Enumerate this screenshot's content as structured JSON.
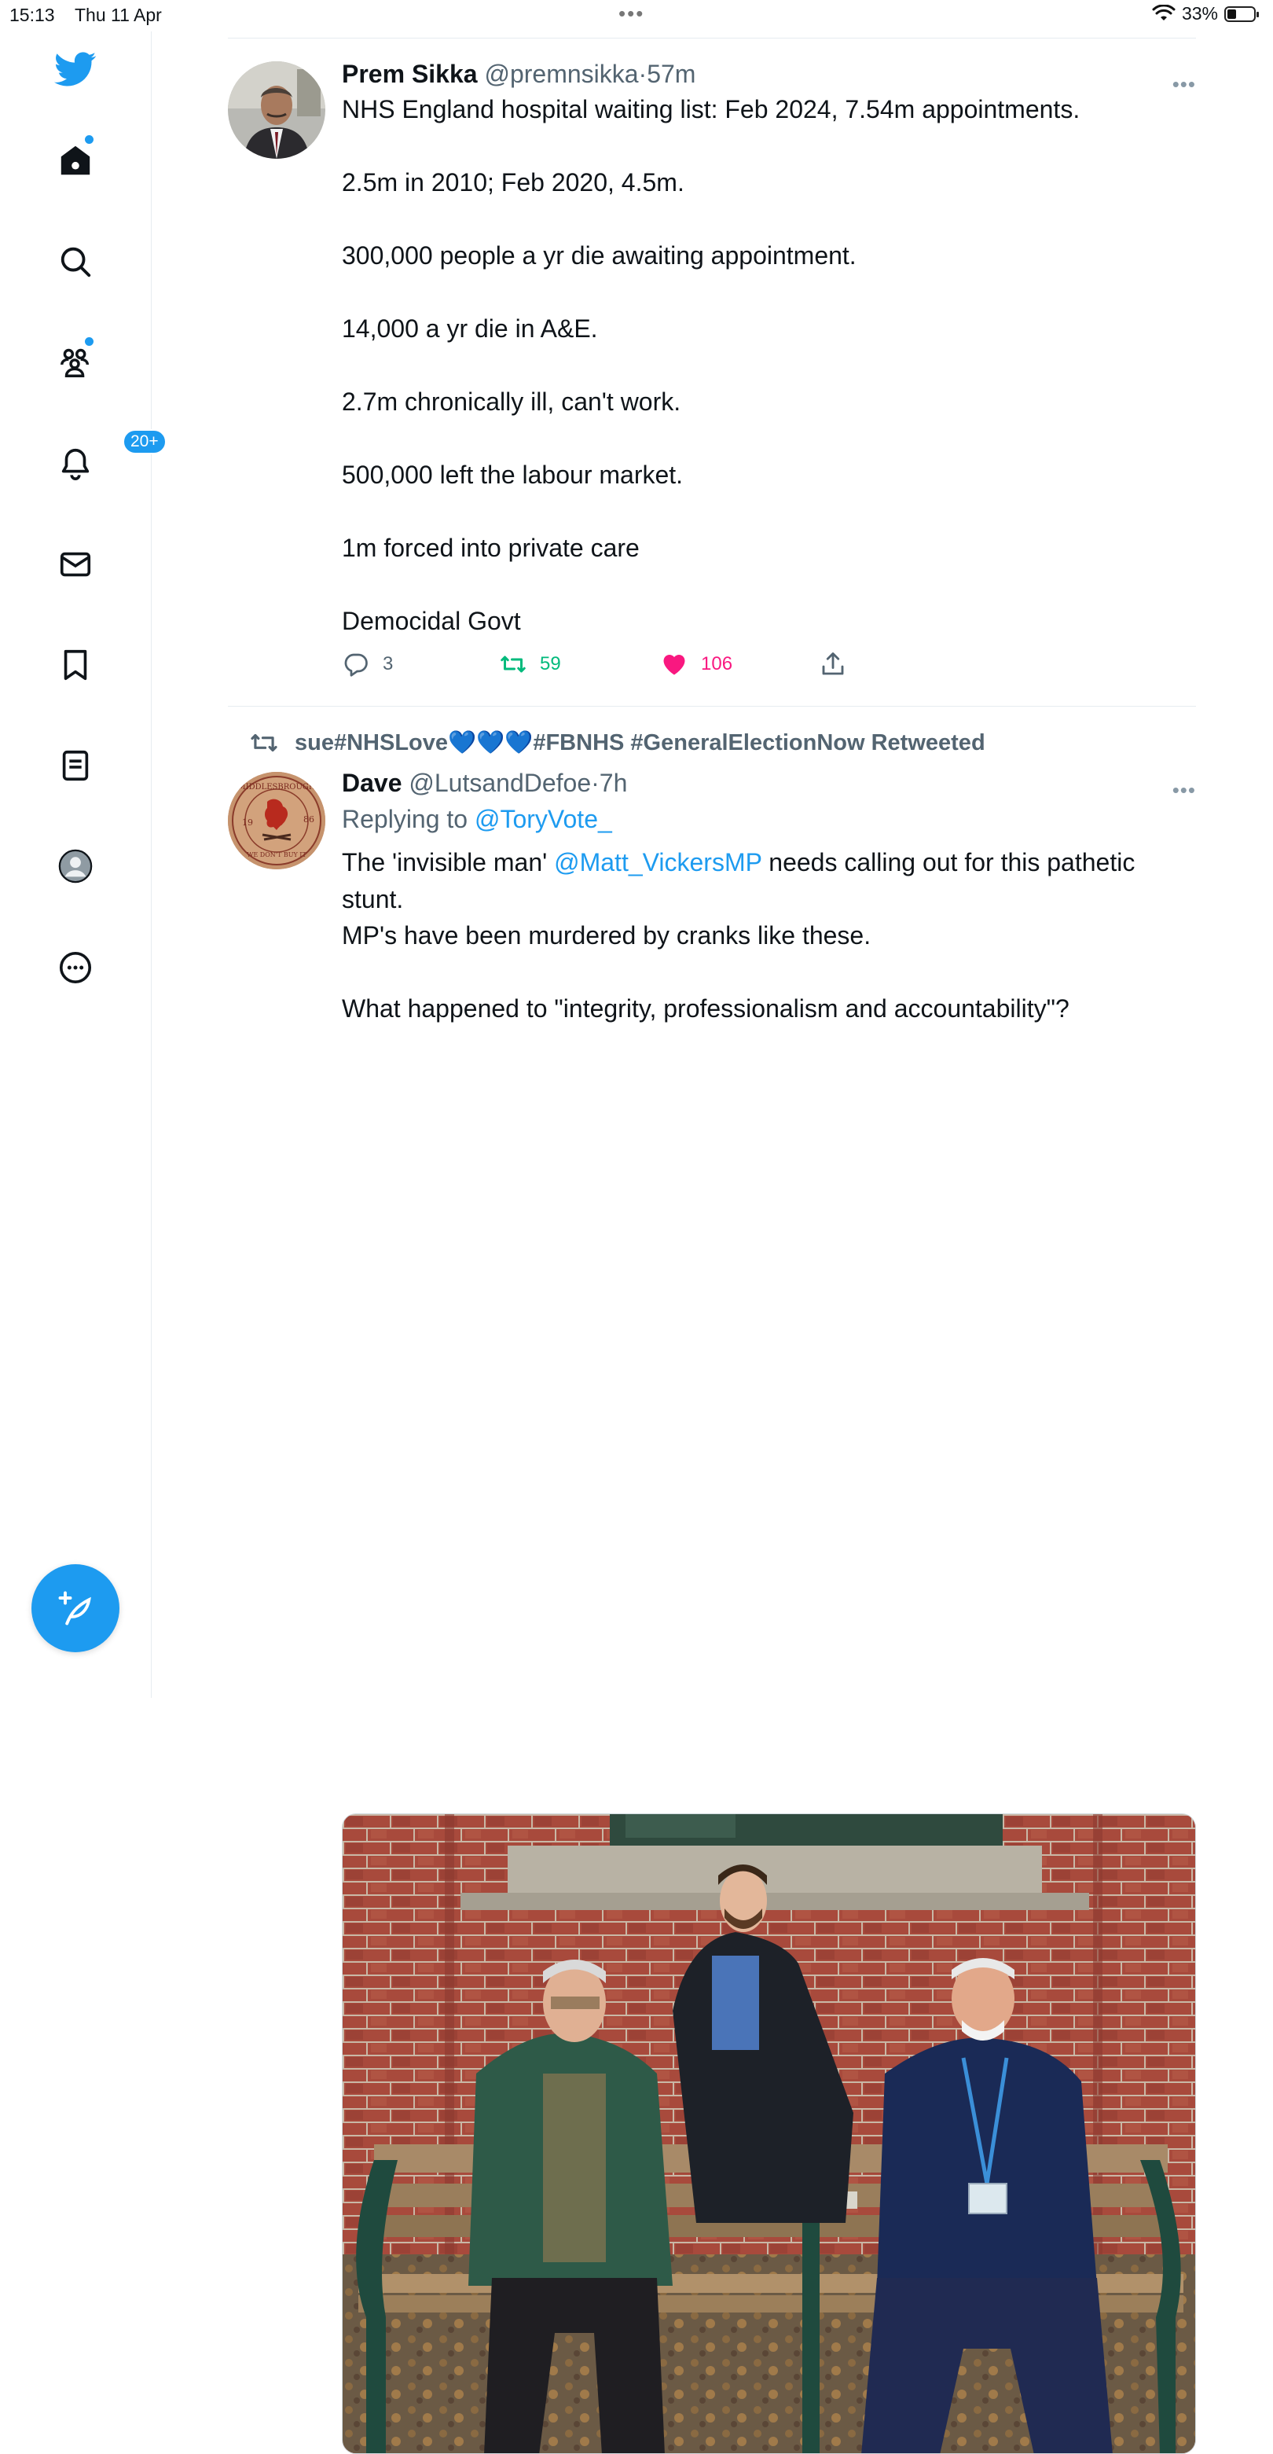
{
  "status_bar": {
    "time": "15:13",
    "date": "Thu 11 Apr",
    "battery": "33%",
    "battery_level": 0.33,
    "dots": "•••"
  },
  "sidebar": {
    "items": [
      {
        "name": "home",
        "has_dot": true
      },
      {
        "name": "search"
      },
      {
        "name": "communities",
        "has_dot": true
      },
      {
        "name": "notifications",
        "badge": "20+"
      },
      {
        "name": "messages"
      },
      {
        "name": "bookmarks"
      },
      {
        "name": "lists"
      },
      {
        "name": "profile"
      },
      {
        "name": "more"
      }
    ]
  },
  "tweets": [
    {
      "name": "Prem Sikka",
      "handle": "@premnsikka",
      "sep": "·",
      "ago": "57m",
      "more": "•••",
      "paragraphs": [
        "NHS England hospital waiting list: Feb 2024, 7.54m appointments.",
        "2.5m in 2010; Feb 2020, 4.5m.",
        "300,000 people a yr die awaiting appointment.",
        "14,000 a yr die in A&E.",
        "2.7m chronically ill, can't work.",
        "500,000 left the labour market.",
        "1m forced into private care",
        "Democidal Govt"
      ],
      "replies": "3",
      "retweets": "59",
      "likes": "106",
      "liked": true
    },
    {
      "retweeted_by": "sue#NHSLove💙💙💙#FBNHS #GeneralElectionNow Retweeted",
      "name": "Dave",
      "handle": "@LutsandDefoe",
      "sep": "·",
      "ago": "7h",
      "more": "•••",
      "replying_prefix": "Replying to ",
      "replying_to": "@ToryVote_",
      "text_before_mention": "The 'invisible man' ",
      "mention": "@Matt_VickersMP",
      "text_after_mention": " needs calling out for this pathetic stunt.",
      "line2": "MP's have been murdered by cranks like these.",
      "line3": "What happened to \"integrity, professionalism and accountability\"?",
      "avatar_badge": {
        "top": "MIDDLESBROUGH",
        "left": "19",
        "right": "86",
        "mid": "F  C",
        "bottom": "WE DON'T BUY IT"
      }
    }
  ],
  "colors": {
    "accent": "#1d9bf0",
    "retweet": "#00ba7c",
    "like": "#f91880",
    "secondary": "#536471"
  }
}
